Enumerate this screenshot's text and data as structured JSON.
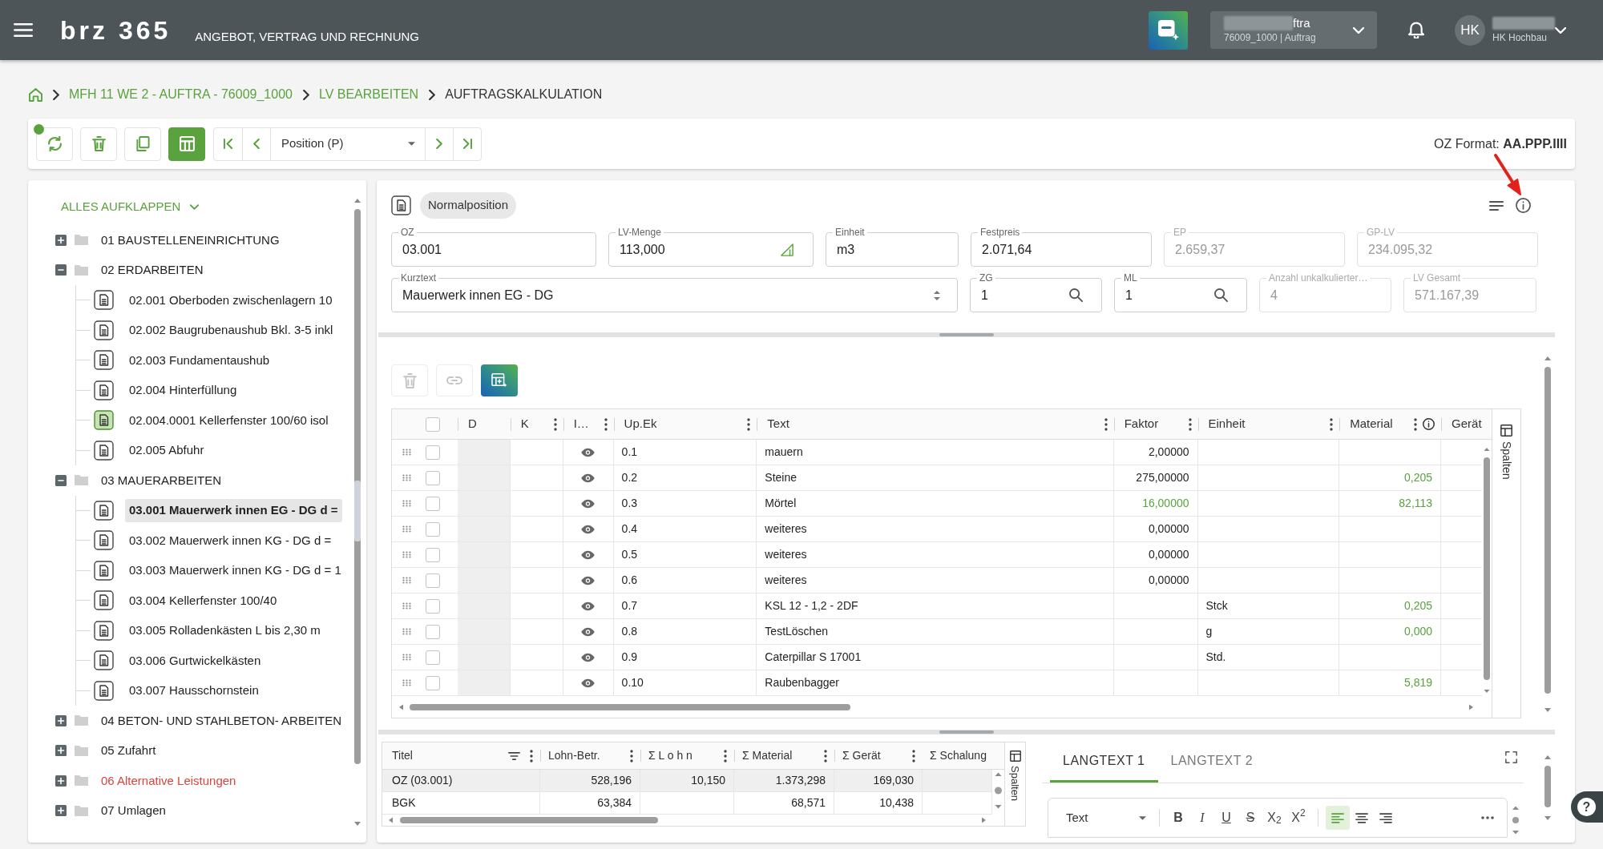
{
  "header": {
    "logo": "brz 365",
    "app_title": "ANGEBOT, VERTRAG UND RECHNUNG",
    "project": {
      "title": "ftra",
      "title_redacted": true,
      "subtitle": "76009_1000 | Auftrag"
    },
    "user": {
      "initials": "HK",
      "name_redacted": true,
      "company": "HK Hochbau"
    }
  },
  "breadcrumb": [
    {
      "kind": "link",
      "label": "MFH 11 WE 2 - AUFTRA - 76009_1000"
    },
    {
      "kind": "link",
      "label": "LV BEARBEITEN"
    },
    {
      "kind": "current",
      "label": "AUFTRAGSKALKULATION"
    }
  ],
  "toolbar": {
    "buttons": [
      {
        "kind": "refresh",
        "active": false,
        "indicator": true
      },
      {
        "kind": "delete",
        "active": false,
        "indicator": false
      },
      {
        "kind": "copy",
        "active": false,
        "indicator": false
      },
      {
        "kind": "calculation",
        "active": true,
        "indicator": false
      }
    ],
    "navigation": [
      {
        "kind": "first"
      },
      {
        "kind": "previous"
      },
      {
        "kind": "select",
        "value": "Position (P)"
      },
      {
        "kind": "next"
      },
      {
        "kind": "last"
      }
    ],
    "oz_format": "OZ Format: **AA.PPP.IIII**"
  },
  "tree": {
    "expand_all": "ALLES AUFKLAPPEN",
    "items": [
      {
        "kind": "folder",
        "label": "01 BAUSTELLENEINRICHTUNG",
        "expanded": false,
        "alternative": false,
        "selected": false
      },
      {
        "kind": "folder",
        "label": "02 ERDARBEITEN",
        "expanded": true,
        "alternative": false,
        "selected": false,
        "children": [
          {
            "kind": "position",
            "label": "02.001 Oberboden zwischenlagern 10",
            "selected": false,
            "marked": false
          },
          {
            "kind": "position",
            "label": "02.002 Baugrubenaushub Bkl. 3-5 inkl",
            "selected": false,
            "marked": false
          },
          {
            "kind": "position",
            "label": "02.003 Fundamentaushub",
            "selected": false,
            "marked": false
          },
          {
            "kind": "position",
            "label": "02.004 Hinterfüllung",
            "selected": false,
            "marked": false
          },
          {
            "kind": "position",
            "label": "02.004.0001 Kellerfenster 100/60 isol",
            "selected": false,
            "marked": true
          },
          {
            "kind": "position",
            "label": "02.005 Abfuhr",
            "selected": false,
            "marked": false
          }
        ]
      },
      {
        "kind": "folder",
        "label": "03 MAUERARBEITEN",
        "expanded": true,
        "alternative": false,
        "selected": false,
        "children": [
          {
            "kind": "position",
            "label": "03.001 Mauerwerk innen EG - DG d =",
            "selected": true,
            "marked": false
          },
          {
            "kind": "position",
            "label": "03.002 Mauerwerk innen KG - DG d =",
            "selected": false,
            "marked": false
          },
          {
            "kind": "position",
            "label": "03.003 Mauerwerk innen KG - DG d = 1",
            "selected": false,
            "marked": false
          },
          {
            "kind": "position",
            "label": "03.004 Kellerfenster 100/40",
            "selected": false,
            "marked": false
          },
          {
            "kind": "position",
            "label": "03.005 Rolladenkästen L bis 2,30 m",
            "selected": false,
            "marked": false
          },
          {
            "kind": "position",
            "label": "03.006 Gurtwickelkästen",
            "selected": false,
            "marked": false
          },
          {
            "kind": "position",
            "label": "03.007 Hausschornstein",
            "selected": false,
            "marked": false
          }
        ]
      },
      {
        "kind": "folder",
        "label": "04 BETON- UND STAHLBETON- ARBEITEN",
        "expanded": false,
        "alternative": false,
        "selected": false
      },
      {
        "kind": "folder",
        "label": "05 Zufahrt",
        "expanded": false,
        "alternative": false,
        "selected": false
      },
      {
        "kind": "folder",
        "label": "06 Alternative Leistungen",
        "expanded": false,
        "alternative": true,
        "selected": false
      },
      {
        "kind": "folder",
        "label": "07 Umlagen",
        "expanded": false,
        "alternative": false,
        "selected": false
      }
    ]
  },
  "position": {
    "type_label": "Normalposition",
    "field_rows": [
      [
        {
          "kind": "text",
          "label": "OZ",
          "value": "03.001",
          "disabled": false
        },
        {
          "kind": "quantity",
          "label": "LV-Menge",
          "value": "113,000",
          "disabled": false
        },
        {
          "kind": "text",
          "label": "Einheit",
          "value": "m3",
          "disabled": false
        },
        {
          "kind": "text",
          "label": "Festpreis",
          "value": "2.071,64",
          "disabled": false
        },
        {
          "kind": "text",
          "label": "EP",
          "value": "2.659,37",
          "disabled": true
        },
        {
          "kind": "text",
          "label": "GP-LV",
          "value": "234.095,32",
          "disabled": true
        }
      ],
      [
        {
          "kind": "select",
          "label": "Kurztext",
          "value": "Mauerwerk innen EG - DG",
          "disabled": false
        },
        {
          "kind": "lookup",
          "label": "ZG",
          "value": "1",
          "disabled": false
        },
        {
          "kind": "lookup",
          "label": "ML",
          "value": "1",
          "disabled": false
        },
        {
          "kind": "text",
          "label": "Anzahl unkalkulierter…",
          "value": "4",
          "disabled": true
        },
        {
          "kind": "text",
          "label": "LV Gesamt",
          "value": "571.167,39",
          "disabled": true
        }
      ]
    ]
  },
  "calc_table": {
    "toolbar": [
      {
        "kind": "delete",
        "disabled": true
      },
      {
        "kind": "link",
        "disabled": true
      },
      {
        "kind": "ai_table",
        "disabled": false
      }
    ],
    "select_all_checked": false,
    "columns": [
      {
        "label": "D",
        "menu": false,
        "info": false
      },
      {
        "label": "K",
        "menu": true,
        "info": false
      },
      {
        "label": "I…",
        "menu": true,
        "info": false
      },
      {
        "label": "Up.Ek",
        "menu": true,
        "info": false
      },
      {
        "label": "Text",
        "menu": true,
        "info": false
      },
      {
        "label": "Faktor",
        "menu": true,
        "info": false
      },
      {
        "label": "Einheit",
        "menu": true,
        "info": false
      },
      {
        "label": "Material",
        "menu": true,
        "info": true
      },
      {
        "label": "Gerät",
        "menu": false,
        "info": false
      }
    ],
    "rows": [
      {
        "checked": false,
        "visible": true,
        "up_ek": "0.1",
        "text": "mauern",
        "faktor": "2,00000",
        "faktor_highlighted": false
      },
      {
        "checked": false,
        "visible": true,
        "up_ek": "0.2",
        "text": "Steine",
        "faktor": "275,00000",
        "faktor_highlighted": false,
        "material": "0,205"
      },
      {
        "checked": false,
        "visible": true,
        "up_ek": "0.3",
        "text": "Mörtel",
        "faktor": "16,00000",
        "faktor_highlighted": true,
        "material": "82,113"
      },
      {
        "checked": false,
        "visible": true,
        "up_ek": "0.4",
        "text": "weiteres",
        "faktor": "0,00000",
        "faktor_highlighted": false
      },
      {
        "checked": false,
        "visible": true,
        "up_ek": "0.5",
        "text": "weiteres",
        "faktor": "0,00000",
        "faktor_highlighted": false
      },
      {
        "checked": false,
        "visible": true,
        "up_ek": "0.6",
        "text": "weiteres",
        "faktor": "0,00000",
        "faktor_highlighted": false
      },
      {
        "checked": false,
        "visible": true,
        "up_ek": "0.7",
        "text": "KSL 12 - 1,2 - 2DF",
        "einheit": "Stck",
        "material": "0,205"
      },
      {
        "checked": false,
        "visible": true,
        "up_ek": "0.8",
        "text": "TestLöschen",
        "einheit": "g",
        "material": "0,000"
      },
      {
        "checked": false,
        "visible": true,
        "up_ek": "0.9",
        "text": "Caterpillar S 17001",
        "einheit": "Std."
      },
      {
        "checked": false,
        "visible": true,
        "up_ek": "0.10",
        "text": "Raubenbagger",
        "material": "5,819"
      }
    ],
    "columns_panel": "Spalten"
  },
  "summary_table": {
    "columns": [
      {
        "label": "Titel",
        "filter": true,
        "menu": true
      },
      {
        "label": "Lohn-Betr.",
        "filter": false,
        "menu": true
      },
      {
        "label": "Σ L o h n",
        "filter": false,
        "menu": true
      },
      {
        "label": "Σ Material",
        "filter": false,
        "menu": true
      },
      {
        "label": "Σ Gerät",
        "filter": false,
        "menu": true
      },
      {
        "label": "Σ Schalung",
        "filter": false,
        "menu": false
      }
    ],
    "rows": [
      {
        "selected": true,
        "title": "OZ (03.001)",
        "lohn_betr": "528,196",
        "sum_lohn": "10,150",
        "sum_material": "1.373,298",
        "sum_geraet": "169,030"
      },
      {
        "selected": false,
        "title": "BGK",
        "lohn_betr": "63,384",
        "sum_material": "68,571",
        "sum_geraet": "10,438"
      }
    ],
    "columns_panel": "Spalten"
  },
  "langtext": {
    "tabs": [
      {
        "label": "LANGTEXT 1",
        "selected": true
      },
      {
        "label": "LANGTEXT 2",
        "selected": false
      }
    ],
    "style_select": "Text",
    "tools": [
      {
        "kind": "bold",
        "glyph": "B",
        "active": false
      },
      {
        "kind": "italic",
        "glyph": "I",
        "active": false
      },
      {
        "kind": "underline",
        "glyph": "U",
        "active": false
      },
      {
        "kind": "strike",
        "glyph": "S",
        "active": false
      },
      {
        "kind": "subscript",
        "glyph": "X$_{2}$",
        "active": false
      },
      {
        "kind": "superscript",
        "glyph": "X$^{2}$",
        "active": false
      },
      {
        "kind": "align_left",
        "active": true
      },
      {
        "kind": "align_center",
        "active": false
      },
      {
        "kind": "align_right",
        "active": false
      },
      {
        "kind": "more"
      }
    ]
  },
  "help": {
    "glyph": "?"
  },
  "annotations": [
    {
      "kind": "arrow"
    }
  ]
}
